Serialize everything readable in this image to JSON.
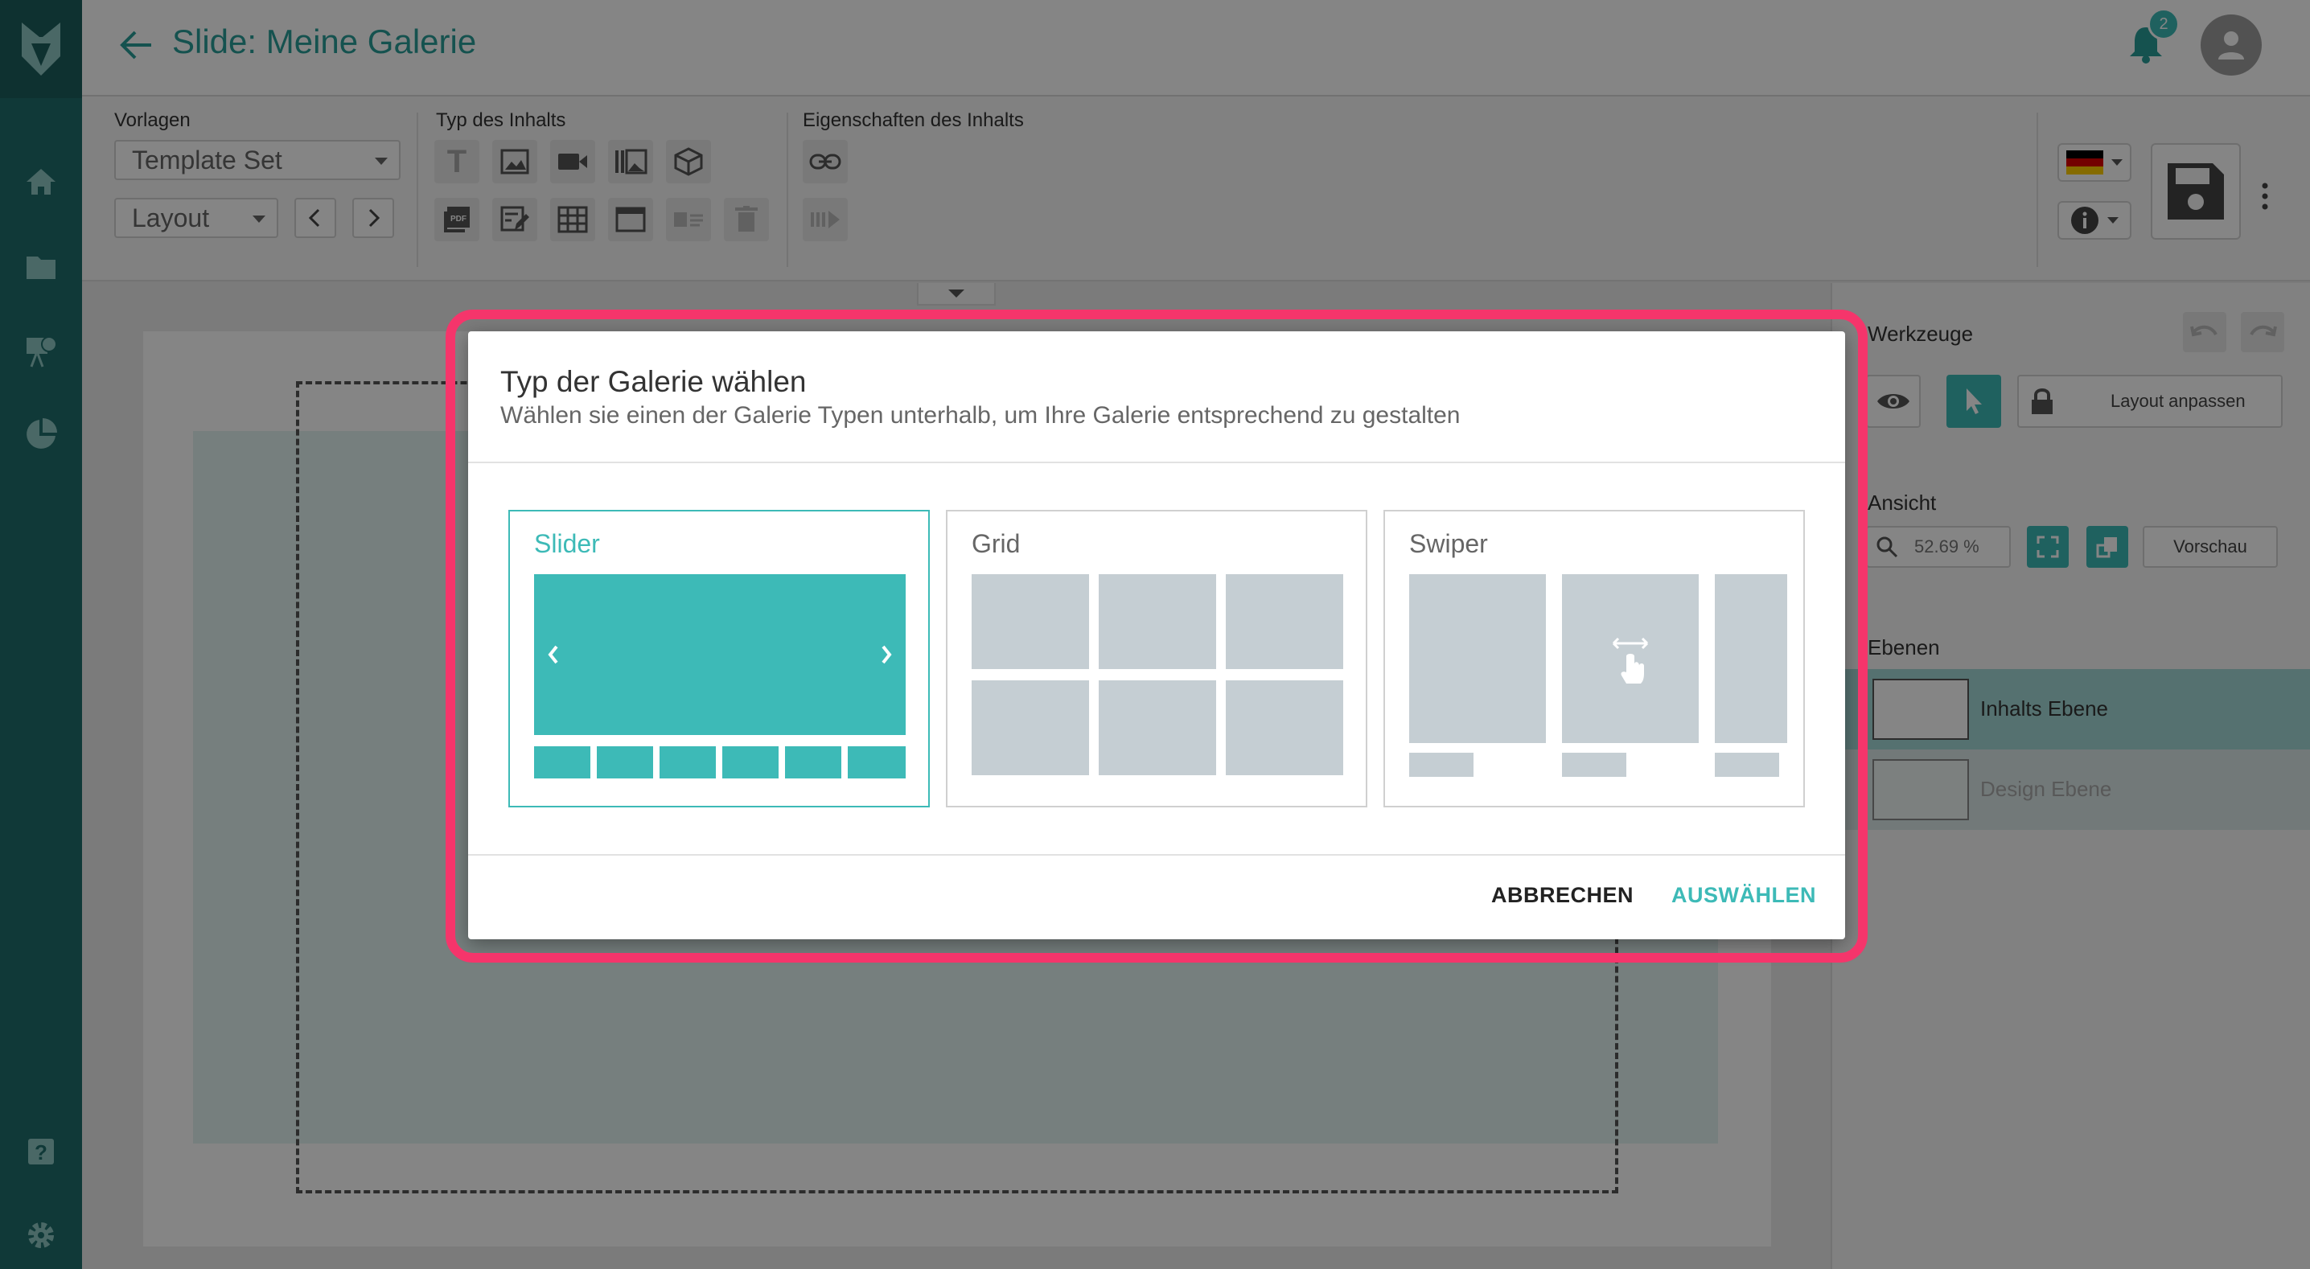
{
  "header": {
    "title": "Slide: Meine Galerie",
    "notification_count": "2"
  },
  "toolbar": {
    "vorlagen_label": "Vorlagen",
    "template_select": "Template Set",
    "layout_select": "Layout",
    "content_type_label": "Typ des Inhalts",
    "properties_label": "Eigenschaften des Inhalts"
  },
  "right_panel": {
    "tools_label": "Werkzeuge",
    "layout_button": "Layout anpassen",
    "view_label": "Ansicht",
    "zoom_value": "52.69 %",
    "preview_button": "Vorschau",
    "layers_label": "Ebenen",
    "layers": [
      {
        "name": "Inhalts Ebene"
      },
      {
        "name": "Design Ebene"
      }
    ]
  },
  "dialog": {
    "title": "Typ der Galerie wählen",
    "subtitle": "Wählen sie einen der Galerie Typen unterhalb, um Ihre Galerie entsprechend zu gestalten",
    "options": [
      {
        "label": "Slider",
        "selected": true
      },
      {
        "label": "Grid",
        "selected": false
      },
      {
        "label": "Swiper",
        "selected": false
      }
    ],
    "cancel_label": "ABBRECHEN",
    "select_label": "AUSWÄHLEN"
  },
  "colors": {
    "accent": "#3dbab7",
    "sidebar": "#1f6e6b",
    "highlight": "#f5356b",
    "placeholder": "#c5ced3"
  }
}
